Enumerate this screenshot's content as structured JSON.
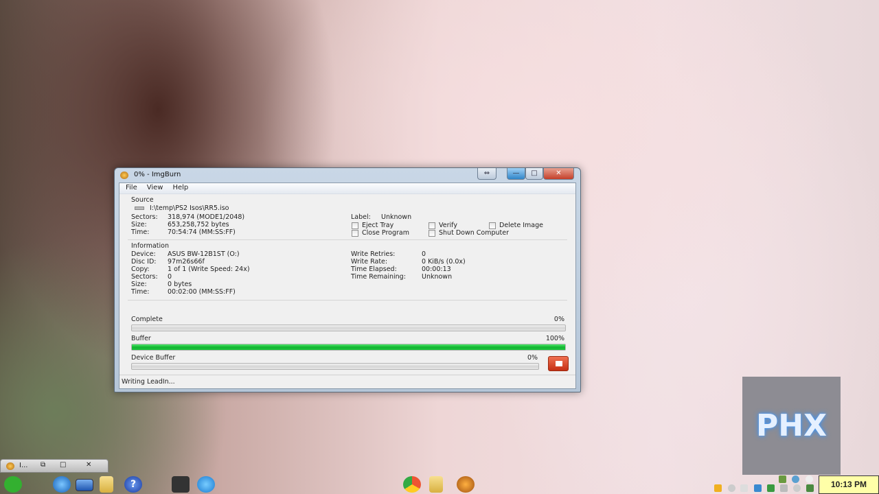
{
  "window": {
    "title": "0% - ImgBurn",
    "menu": [
      "File",
      "View",
      "Help"
    ],
    "controls": {
      "restore": "⇔",
      "minimize": "—",
      "maximize": "□",
      "close": "✕"
    }
  },
  "source": {
    "heading": "Source",
    "path": "I:\\temp\\PS2 Isos\\RR5.iso",
    "rows": [
      {
        "k": "Sectors:",
        "v": "318,974 (MODE1/2048)"
      },
      {
        "k": "Size:",
        "v": "653,258,752 bytes"
      },
      {
        "k": "Time:",
        "v": "70:54:74 (MM:SS:FF)"
      }
    ],
    "label_key": "Label:",
    "label_value": "Unknown"
  },
  "options": [
    {
      "label": "Eject Tray",
      "checked": false
    },
    {
      "label": "Verify",
      "checked": false
    },
    {
      "label": "Delete Image",
      "checked": false
    },
    {
      "label": "Close Program",
      "checked": false
    },
    {
      "label": "Shut Down Computer",
      "checked": false
    }
  ],
  "info": {
    "heading": "Information",
    "rows": [
      {
        "k": "Device:",
        "v": "ASUS BW-12B1ST (O:)"
      },
      {
        "k": "Disc ID:",
        "v": "97m26s66f"
      },
      {
        "k": "Copy:",
        "v": "1 of 1 (Write Speed: 24x)"
      },
      {
        "k": "Sectors:",
        "v": "0"
      },
      {
        "k": "Size:",
        "v": "0 bytes"
      },
      {
        "k": "Time:",
        "v": "00:02:00 (MM:SS:FF)"
      }
    ],
    "stats": [
      {
        "k": "Write Retries:",
        "v": "0"
      },
      {
        "k": "Write Rate:",
        "v": "0 KiB/s (0.0x)"
      },
      {
        "k": "Time Elapsed:",
        "v": "00:00:13"
      },
      {
        "k": "Time Remaining:",
        "v": "Unknown"
      }
    ]
  },
  "progress": [
    {
      "label": "Complete",
      "pct_text": "0%",
      "value": 0
    },
    {
      "label": "Buffer",
      "pct_text": "100%",
      "value": 100
    },
    {
      "label": "Device Buffer",
      "pct_text": "0%",
      "value": 0
    }
  ],
  "status": "Writing LeadIn...",
  "taskbar": {
    "mini_window_label": "I...",
    "clock": "10:13 PM"
  },
  "desktop": {
    "logo_text": "PHX"
  }
}
